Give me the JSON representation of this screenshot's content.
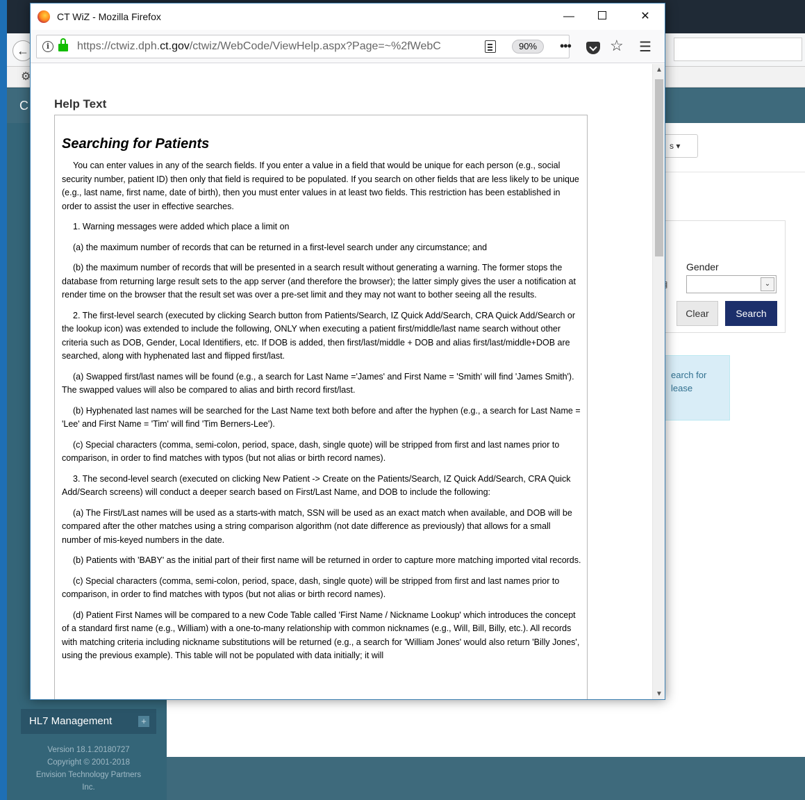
{
  "background": {
    "header_letter": "C",
    "dropdown_text": "s ▾",
    "gender_label": "Gender",
    "clear_label": "Clear",
    "search_label": "Search",
    "info_text": "earch for\nlease",
    "nav_item_label": "HL7 Management",
    "nav_item_plus": "+",
    "version_lines": [
      "Version 18.1.20180727",
      "Copyright © 2001-2018",
      "Envision Technology Partners",
      "Inc."
    ]
  },
  "popup": {
    "window_title": "CT WiZ - Mozilla Firefox",
    "url_prefix": "https://ctwiz.dph.",
    "url_domain": "ct.gov",
    "url_suffix": "/ctwiz/WebCode/ViewHelp.aspx?Page=~%2fWebC",
    "zoom": "90%",
    "minimize_glyph": "—",
    "close_glyph": "✕",
    "more_glyph": "•••",
    "star_glyph": "☆",
    "menu_glyph": "☰",
    "help_title": "Help Text",
    "help_heading": "Searching for Patients",
    "paragraphs": [
      "You can enter values in any of the search fields. If you enter a value in a field that would be unique for each person (e.g., social security number, patient ID) then only that field is required to be populated. If you search on other fields that are less likely to be unique (e.g., last name, first name, date of birth), then you must enter values in at least two fields. This restriction has been established in order to assist the user in effective searches.",
      "1. Warning messages were added which place a limit on",
      "(a) the maximum number of records that can be returned in a first-level search under any circumstance; and",
      "(b) the maximum number of records that will be presented in a search result without generating a warning. The former stops the database from returning large result sets to the app server (and therefore the browser); the latter simply gives the user a notification at render time on the browser that the result set was over a pre-set limit and they may not want to bother seeing all the results.",
      "2. The first-level search (executed by clicking Search button from Patients/Search, IZ Quick Add/Search, CRA Quick Add/Search or the lookup icon) was extended to include the following, ONLY when executing a patient first/middle/last name search without other criteria such as DOB, Gender, Local Identifiers, etc. If DOB is added, then first/last/middle + DOB and alias first/last/middle+DOB are searched, along with hyphenated last and flipped first/last.",
      "(a) Swapped first/last names will be found (e.g., a search for Last Name ='James' and First Name = 'Smith' will find 'James Smith'). The swapped values will also be compared to alias and birth record first/last.",
      "(b) Hyphenated last names will be searched for the Last Name text both before and after the hyphen (e.g., a search for Last Name = 'Lee' and First Name = 'Tim' will find 'Tim Berners-Lee').",
      "(c) Special characters (comma, semi-colon, period, space, dash, single quote) will be stripped from first and last names prior to comparison, in order to find matches with typos (but not alias or birth record names).",
      "3. The second-level search (executed on clicking New Patient -> Create on the Patients/Search, IZ Quick Add/Search, CRA Quick Add/Search screens) will conduct a deeper search based on First/Last Name, and DOB to include the following:",
      "(a) The First/Last names will be used as a starts-with match, SSN will be used as an exact match when available, and DOB will be compared after the other matches using a string comparison algorithm (not date difference as previously) that allows for a small number of mis-keyed numbers in the date.",
      "(b) Patients with 'BABY' as the initial part of their first name will be returned in order to capture more matching imported vital records.",
      "(c) Special characters (comma, semi-colon, period, space, dash, single quote) will be stripped from first and last names prior to comparison, in order to find matches with typos (but not alias or birth record names).",
      "(d) Patient First Names will be compared to a new Code Table called 'First Name / Nickname Lookup' which introduces the concept of a standard first name (e.g., William) with a one-to-many relationship with common nicknames (e.g., Will, Bill, Billy, etc.). All records with matching criteria including nickname substitutions will be returned (e.g., a search for 'William Jones' would also return 'Billy Jones', using the previous example). This table will not be populated with data initially; it will"
    ]
  }
}
